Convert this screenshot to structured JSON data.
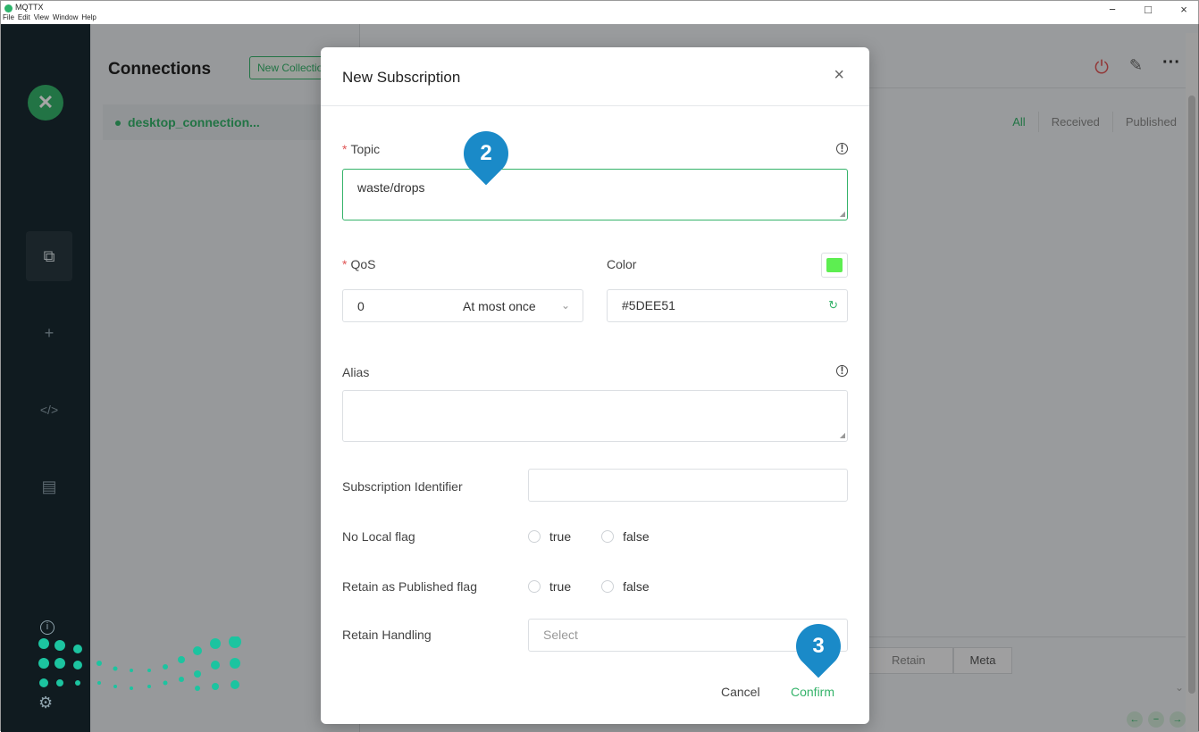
{
  "titlebar": {
    "app_title": "MQTTX",
    "menu": [
      "File",
      "Edit",
      "View",
      "Window",
      "Help"
    ],
    "minimize": "−",
    "maximize": "□",
    "close": "×"
  },
  "connections": {
    "title": "Connections",
    "new_collection": "New Collection",
    "item_label": "desktop_connection..."
  },
  "main": {
    "tabs": [
      "All",
      "Received",
      "Published"
    ],
    "retain_label": "Retain",
    "meta_label": "Meta"
  },
  "dialog": {
    "title": "New Subscription",
    "close_icon": "×",
    "topic_label": "Topic",
    "topic_value": "waste/drops",
    "qos_label": "QoS",
    "qos_value": "0",
    "qos_description": "At most once",
    "color_label": "Color",
    "color_value": "#5DEE51",
    "alias_label": "Alias",
    "sub_id_label": "Subscription Identifier",
    "no_local_label": "No Local flag",
    "retain_published_label": "Retain as Published flag",
    "retain_handling_label": "Retain Handling",
    "retain_handling_placeholder": "Select",
    "radio_true": "true",
    "radio_false": "false",
    "cancel": "Cancel",
    "confirm": "Confirm"
  },
  "markers": {
    "marker_2": "2",
    "marker_3": "3"
  },
  "colors": {
    "accent": "#35b36a",
    "marker": "#1a8ac8",
    "swatch": "#5DEE51",
    "sidebar": "#1a2a32"
  }
}
